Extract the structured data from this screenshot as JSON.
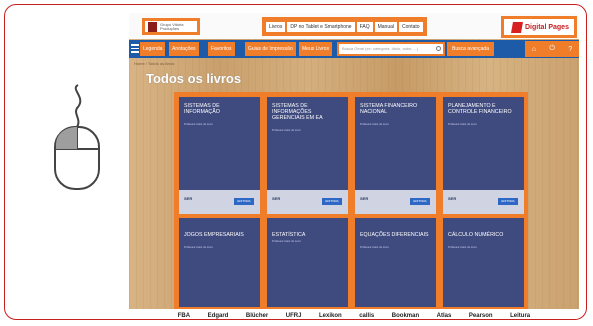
{
  "header": {
    "logo_line1": "Grupo Vitória",
    "logo_line2": "Produções",
    "nav": [
      "Livros",
      "DP no Tablet e Smartphone",
      "FAQ",
      "Manual",
      "Contato"
    ],
    "brand": "Digital Pages"
  },
  "navbar": {
    "items": [
      "Legenda",
      "Anotações",
      "Favoritos",
      "Guias de Impressão",
      "Meus Livros"
    ],
    "search_placeholder": "Busca Geral (ex: categoria, título, autor, ...)",
    "advanced_search": "Busca avançada"
  },
  "breadcrumb": "Home / Todos os livros",
  "page_title": "Todos os livros",
  "books": [
    {
      "title": "Sistemas de Informação",
      "author": "Professor Autor do Livro",
      "brand": "SER",
      "tag": "EDITORA"
    },
    {
      "title": "Sistemas de Informações Gerenciais em EA",
      "author": "Professor Autor do Livro",
      "brand": "SER",
      "tag": "EDITORA"
    },
    {
      "title": "Sistema Financeiro Nacional",
      "author": "Professor Autor do Livro",
      "brand": "SER",
      "tag": "EDITORA"
    },
    {
      "title": "Planejamento e Controle Financeiro",
      "author": "Professor Autor do Livro",
      "brand": "SER",
      "tag": "EDITORA"
    },
    {
      "title": "Jogos Empresariais",
      "author": "Professor Autor do Livro",
      "brand": "",
      "tag": ""
    },
    {
      "title": "Estatística",
      "author": "Professor Autor do Livro",
      "brand": "",
      "tag": ""
    },
    {
      "title": "Equações Diferenciais",
      "author": "Professor Autor do Livro",
      "brand": "",
      "tag": ""
    },
    {
      "title": "Cálculo Numérico",
      "author": "Professor Autor do Livro",
      "brand": "",
      "tag": ""
    }
  ],
  "sponsors": [
    "FBA",
    "Edgard",
    "Blücher",
    "UFRJ",
    "Lexikon",
    "callis",
    "Bookman",
    "Atlas",
    "Pearson",
    "Leitura"
  ],
  "colors": {
    "frame_border": "#c81e1e",
    "highlight": "#f07d2a",
    "navbar": "#1d5aa8",
    "book_cover": "#3f4a7e"
  }
}
